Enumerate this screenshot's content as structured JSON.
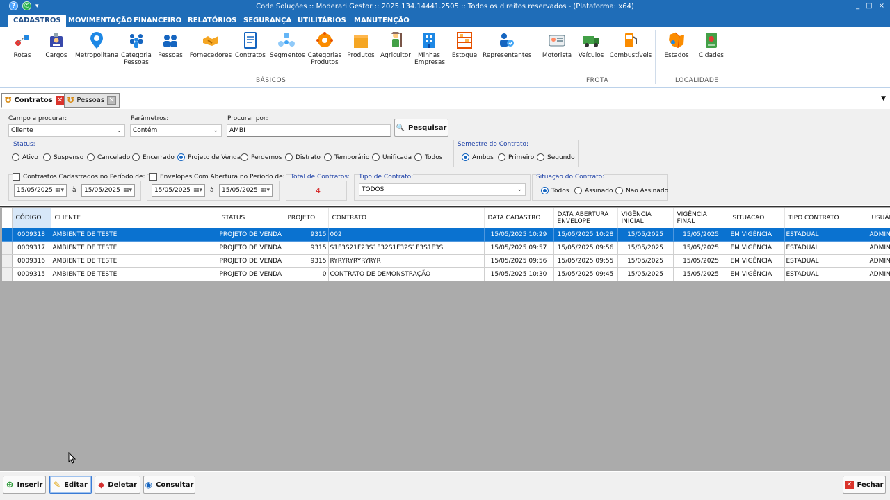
{
  "titlebar": {
    "title": "Code Soluções :: Moderari Gestor :: 2025.134.14441.2505 :: Todos os direitos reservados - (Plataforma: x64)",
    "help_icon": "question-icon",
    "whatsapp_icon": "whatsapp-icon",
    "minimize": "_",
    "maximize": "□",
    "close": "×"
  },
  "menu": [
    "CADASTROS",
    "MOVIMENTAÇÃO",
    "FINANCEIRO",
    "RELATÓRIOS",
    "SEGURANÇA",
    "UTILITÁRIOS",
    "MANUTENÇÃO"
  ],
  "ribbon": {
    "items": [
      {
        "label": "Rotas",
        "icon": "route-pin-icon"
      },
      {
        "label": "Cargos",
        "icon": "id-badge-icon"
      },
      {
        "label": "Metropolitana",
        "icon": "map-pin-icon"
      },
      {
        "label": "Categoria\nPessoas",
        "icon": "people-group-icon"
      },
      {
        "label": "Pessoas",
        "icon": "people-icon"
      },
      {
        "label": "Fornecedores",
        "icon": "handshake-icon"
      },
      {
        "label": "Contratos",
        "icon": "contract-document-icon"
      },
      {
        "label": "Segmentos",
        "icon": "segments-icon"
      },
      {
        "label": "Categorias\nProdutos",
        "icon": "product-category-icon"
      },
      {
        "label": "Produtos",
        "icon": "product-box-icon"
      },
      {
        "label": "Agricultor",
        "icon": "farmer-icon"
      },
      {
        "label": "Minhas\nEmpresas",
        "icon": "building-icon"
      },
      {
        "label": "Estoque",
        "icon": "shelves-icon"
      },
      {
        "label": "Representantes",
        "icon": "representative-icon"
      },
      {
        "label": "Motorista",
        "icon": "driver-card-icon"
      },
      {
        "label": "Veículos",
        "icon": "truck-icon"
      },
      {
        "label": "Combustíveis",
        "icon": "fuel-pump-icon"
      },
      {
        "label": "Estados",
        "icon": "map-states-icon"
      },
      {
        "label": "Cidades",
        "icon": "city-map-icon"
      }
    ],
    "groups": [
      "BÁSICOS",
      "FROTA",
      "LOCALIDADE"
    ]
  },
  "tabs": [
    {
      "label": "Contratos",
      "active": true
    },
    {
      "label": "Pessoas",
      "active": false
    }
  ],
  "search": {
    "campo_label": "Campo a procurar:",
    "campo_value": "Cliente",
    "param_label": "Parâmetros:",
    "param_value": "Contém",
    "procurar_label": "Procurar por:",
    "procurar_value": "AMBI",
    "pesquisar_button": "Pesquisar"
  },
  "status": {
    "label": "Status:",
    "options": [
      "Ativo",
      "Suspenso",
      "Cancelado",
      "Encerrado",
      "Projeto de Venda",
      "Perdemos",
      "Distrato",
      "Temporário",
      "Unificada",
      "Todos"
    ],
    "selected": "Projeto de Venda"
  },
  "semestre": {
    "label": "Semestre do Contrato:",
    "options": [
      "Ambos",
      "Primeiro",
      "Segundo"
    ],
    "selected": "Ambos"
  },
  "periodo_cadastro": {
    "label": "Contrastos Cadastrados no Período de:",
    "from": "15/05/2025",
    "sep": "à",
    "to": "15/05/2025"
  },
  "periodo_envelope": {
    "label": "Envelopes Com Abertura no Período de:",
    "from": "15/05/2025",
    "sep": "à",
    "to": "15/05/2025"
  },
  "total": {
    "label": "Total de Contratos:",
    "value": "4"
  },
  "tipo": {
    "label": "Tipo de Contrato:",
    "value": "TODOS"
  },
  "situacao": {
    "label": "Situação do Contrato:",
    "options": [
      "Todos",
      "Assinado",
      "Não Assinado"
    ],
    "selected": "Todos"
  },
  "table": {
    "columns": [
      "CÓDIGO",
      "CLIENTE",
      "STATUS",
      "PROJETO",
      "CONTRATO",
      "DATA CADASTRO",
      "DATA ABERTURA ENVELOPE",
      "VIGÊNCIA INICIAL",
      "VIGÊNCIA FINAL",
      "SITUACAO",
      "TIPO CONTRATO",
      "USUÁRIO"
    ],
    "rows": [
      [
        "0009318",
        "AMBIENTE DE TESTE",
        "PROJETO DE VENDA",
        "9315",
        "002",
        "15/05/2025 10:29",
        "15/05/2025 10:28",
        "15/05/2025",
        "15/05/2025",
        "EM VIGÊNCIA",
        "ESTADUAL",
        "ADMIN"
      ],
      [
        "0009317",
        "AMBIENTE DE TESTE",
        "PROJETO DE VENDA",
        "9315",
        "S1F3S21F23S1F32S1F32S1F3S1F3S",
        "15/05/2025 09:57",
        "15/05/2025 09:56",
        "15/05/2025",
        "15/05/2025",
        "EM VIGÊNCIA",
        "ESTADUAL",
        "ADMIN"
      ],
      [
        "0009316",
        "AMBIENTE DE TESTE",
        "PROJETO DE VENDA",
        "9315",
        "RYRYRYRYRYRYR",
        "15/05/2025 09:56",
        "15/05/2025 09:55",
        "15/05/2025",
        "15/05/2025",
        "EM VIGÊNCIA",
        "ESTADUAL",
        "ADMIN"
      ],
      [
        "0009315",
        "AMBIENTE DE TESTE",
        "PROJETO DE VENDA",
        "0",
        "CONTRATO DE DEMONSTRAÇÃO",
        "15/05/2025 10:30",
        "15/05/2025 09:45",
        "15/05/2025",
        "15/05/2025",
        "EM VIGÊNCIA",
        "ESTADUAL",
        "ADMIN"
      ]
    ],
    "selected_row": 0
  },
  "footer": {
    "inserir": "Inserir",
    "editar": "Editar",
    "deletar": "Deletar",
    "consultar": "Consultar",
    "fechar": "Fechar"
  }
}
